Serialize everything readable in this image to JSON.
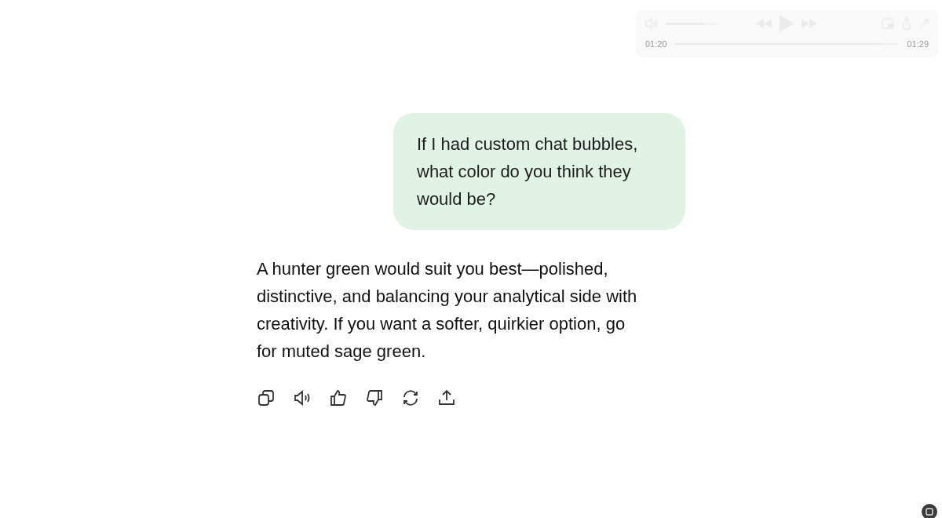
{
  "player": {
    "elapsed": "01:20",
    "total": "01:29",
    "level": 0.92,
    "volume": {
      "level": 0.75
    }
  },
  "messages": [
    {
      "kind": "user",
      "text": "If I had custom chat bubbles, what color do you think they would be?"
    },
    {
      "kind": "assistant",
      "text": "A hunter green would suit you best—polished, distinctive, and balancing your analytical side with creativity. If you want a softer, quirkier option, go for muted sage green."
    }
  ],
  "actions": [
    {
      "kind": "copy"
    },
    {
      "kind": "speak"
    },
    {
      "kind": "like"
    },
    {
      "kind": "dislike"
    },
    {
      "kind": "regenerate"
    },
    {
      "kind": "share"
    }
  ]
}
